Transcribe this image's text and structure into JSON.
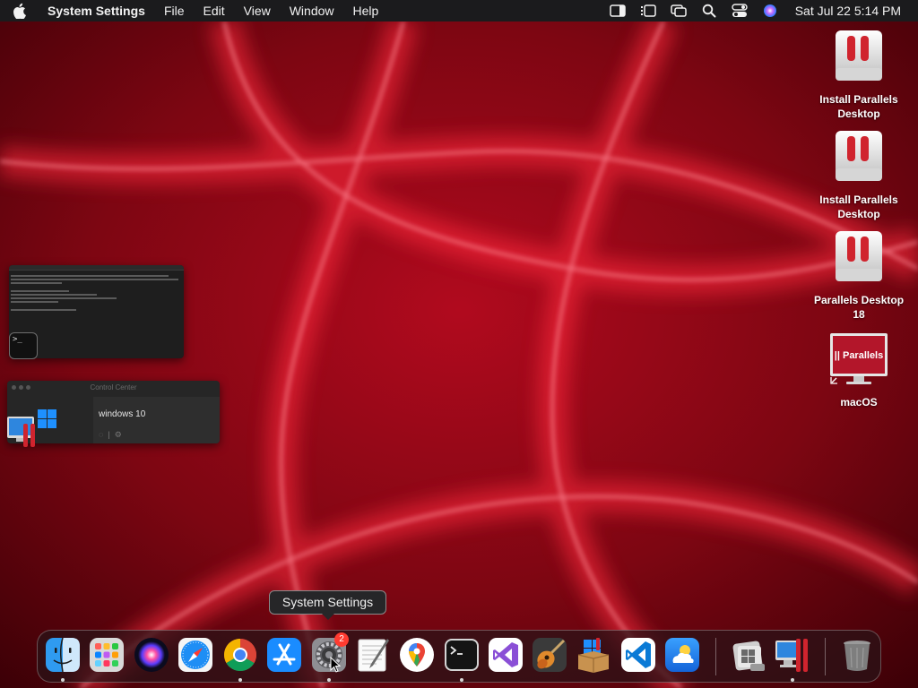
{
  "menubar": {
    "app_name": "System Settings",
    "items": [
      "File",
      "Edit",
      "View",
      "Window",
      "Help"
    ],
    "clock": "Sat Jul 22  5:14 PM",
    "status_icons": [
      "sidebar-icon",
      "stage-manager-icon",
      "screen-mirroring-icon",
      "spotlight-search-icon",
      "control-center-icon",
      "siri-icon"
    ]
  },
  "desktop": {
    "icons": [
      {
        "label": "Install Parallels Desktop",
        "icon": "parallels-installer-icon"
      },
      {
        "label": "Install Parallels Desktop",
        "icon": "parallels-installer-icon"
      },
      {
        "label": "Parallels Desktop 18",
        "icon": "parallels-installer-icon"
      },
      {
        "label": "macOS",
        "icon": "parallels-vm-icon"
      }
    ],
    "vm_logo_text": "|| Parallels"
  },
  "stage_manager": {
    "terminal_prompt": ">_",
    "control_center": {
      "title": "Control Center",
      "vm_name": "windows 10"
    }
  },
  "tooltip": "System Settings",
  "dock": {
    "apps": [
      "Finder",
      "Launchpad",
      "Siri",
      "Safari",
      "Google Chrome",
      "App Store",
      "System Settings",
      "TextEdit",
      "Google Maps",
      "Terminal",
      "Visual Studio",
      "Instruments",
      "Windows Package",
      "Visual Studio Code",
      "Weather",
      "Boot Camp Assistant",
      "Parallels Desktop",
      "Trash"
    ],
    "badge_count": "2"
  }
}
